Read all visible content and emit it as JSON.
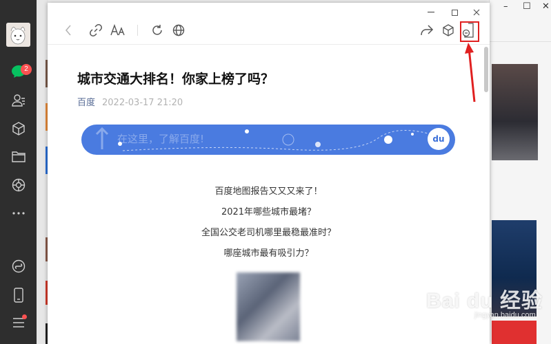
{
  "sidebar": {
    "unread_badge": "2",
    "items": [
      "chat",
      "contacts",
      "mini-programs",
      "files",
      "moments",
      "more",
      "mini-program-panel",
      "phone",
      "menu"
    ]
  },
  "article": {
    "title": "城市交通大排名！你家上榜了吗？",
    "author": "百度",
    "date": "2022-03-17 21:20",
    "banner_text": "在这里，了解百度!",
    "banner_logo": "du",
    "lines": [
      "百度地图报告又又又来了！",
      "2021年哪些城市最堵？",
      "全国公交老司机哪里最稳最准时？",
      "哪座城市最有吸引力？"
    ]
  },
  "watermark": {
    "brand": "Bai du 经验",
    "url": "jingyan.baidu.com"
  },
  "colors": {
    "accent_red": "#e02020",
    "link_blue": "#576b95",
    "banner_blue": "#4a7be0",
    "sidebar_dark": "#2e2e2e"
  }
}
